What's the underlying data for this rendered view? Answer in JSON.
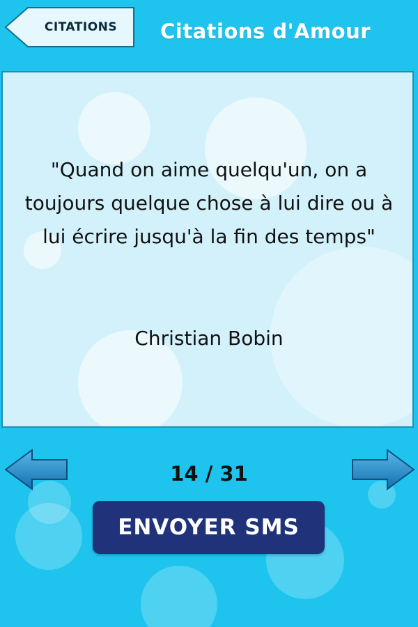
{
  "header": {
    "back_label": "CITATIONS",
    "title": "Citations d'Amour"
  },
  "quote": {
    "text": "\"Quand on aime quelqu'un, on a toujours quelque chose à lui dire ou à lui écrire jusqu'à la fin des temps\"",
    "author": "Christian Bobin"
  },
  "navigation": {
    "counter": "14 / 31",
    "prev_icon": "arrow-left-icon",
    "next_icon": "arrow-right-icon"
  },
  "actions": {
    "sms_label": "ENVOYER SMS"
  },
  "colors": {
    "background": "#1ec4ee",
    "card": "#d2f1fb",
    "button": "#20337a",
    "arrow": "#1b86c4"
  }
}
